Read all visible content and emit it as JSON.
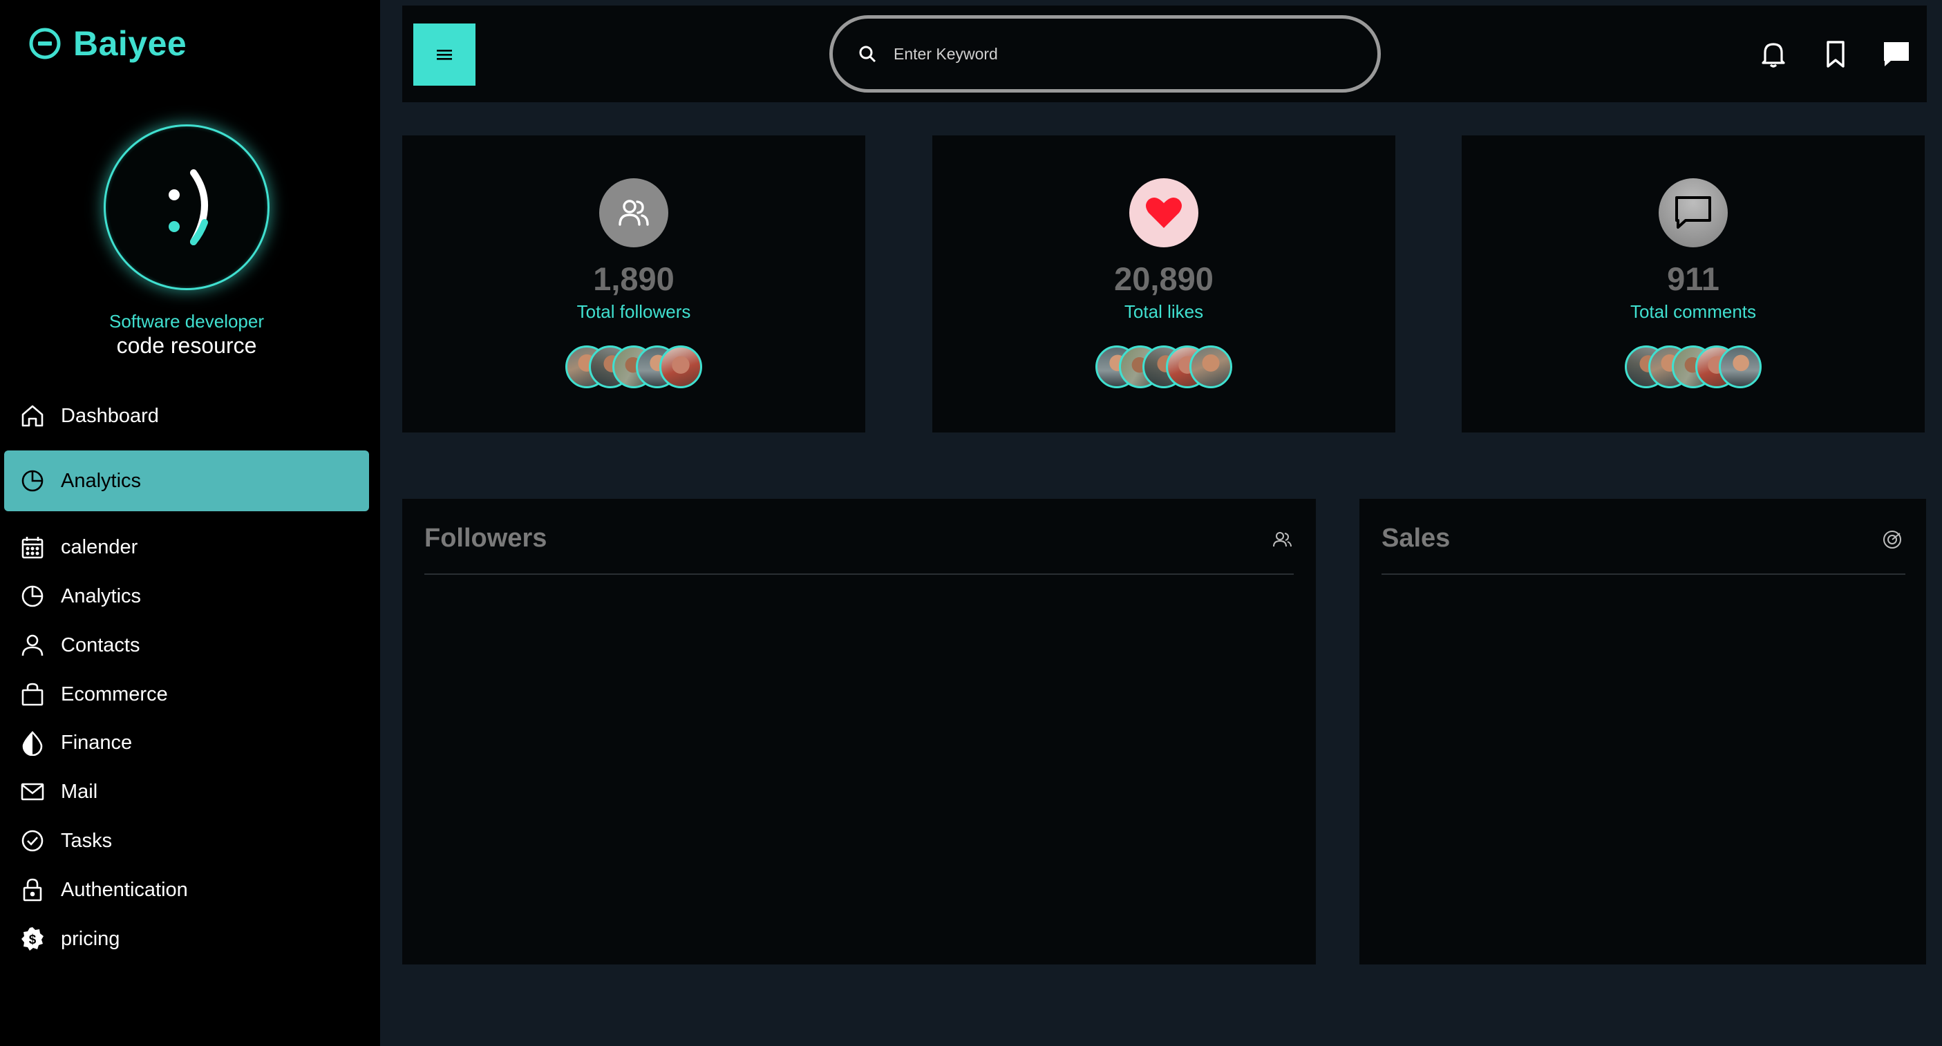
{
  "brand": {
    "name": "Baiyee",
    "icon": "minus-circle-icon"
  },
  "profile": {
    "avatar_text": ":)",
    "role": "Software developer",
    "org": "code resource"
  },
  "sidebar": {
    "items": [
      {
        "label": "Dashboard",
        "icon": "home-icon",
        "active": false
      },
      {
        "label": "Analytics",
        "icon": "pie-chart-icon",
        "active": true
      },
      {
        "label": "calender",
        "icon": "calendar-icon",
        "active": false
      },
      {
        "label": "Analytics",
        "icon": "pie-chart-icon",
        "active": false
      },
      {
        "label": "Contacts",
        "icon": "person-icon",
        "active": false
      },
      {
        "label": "Ecommerce",
        "icon": "shopping-bag-icon",
        "active": false
      },
      {
        "label": "Finance",
        "icon": "half-drop-icon",
        "active": false
      },
      {
        "label": "Mail",
        "icon": "envelope-icon",
        "active": false
      },
      {
        "label": "Tasks",
        "icon": "check-circle-icon",
        "active": false
      },
      {
        "label": "Authentication",
        "icon": "lock-icon",
        "active": false
      },
      {
        "label": "pricing",
        "icon": "dollar-badge-icon",
        "active": false
      }
    ]
  },
  "topbar": {
    "menu_icon": "hamburger-icon",
    "search": {
      "placeholder": "Enter Keyword",
      "value": "",
      "icon": "search-icon"
    },
    "icons": [
      "bell-icon",
      "bookmark-icon",
      "chat-icon"
    ]
  },
  "stats": [
    {
      "value": "1,890",
      "label": "Total followers",
      "icon": "users-icon",
      "circle_color": "#8a8a8a",
      "avatars": 5
    },
    {
      "value": "20,890",
      "label": "Total likes",
      "icon": "heart-icon",
      "circle_color": "#f7d4d8",
      "avatars": 5
    },
    {
      "value": "911",
      "label": "Total comments",
      "icon": "comment-icon",
      "circle_color": "#9a9a9a",
      "avatars": 5
    }
  ],
  "panels": {
    "followers": {
      "title": "Followers",
      "icon": "users-icon"
    },
    "sales": {
      "title": "Sales",
      "icon": "target-icon"
    }
  },
  "colors": {
    "accent": "#40e0d0",
    "active_nav": "#52b8b8",
    "background": "#121b24",
    "card": "#05080a",
    "sidebar": "#000000",
    "heart": "#ff1a2e"
  }
}
